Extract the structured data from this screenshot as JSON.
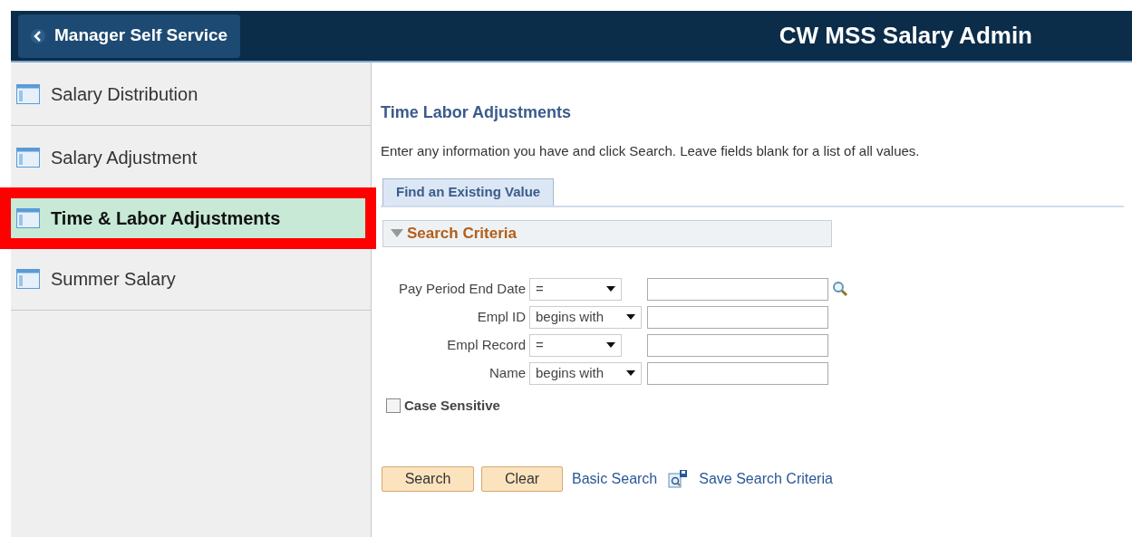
{
  "header": {
    "back_button": "Manager Self Service",
    "title": "CW MSS Salary Admin"
  },
  "sidebar": {
    "items": [
      {
        "label": "Salary Distribution",
        "selected": false,
        "highlighted": false
      },
      {
        "label": "Salary Adjustment",
        "selected": false,
        "highlighted": false
      },
      {
        "label": "Time & Labor Adjustments",
        "selected": true,
        "highlighted": true
      },
      {
        "label": "Summer Salary",
        "selected": false,
        "highlighted": false
      }
    ]
  },
  "page": {
    "title": "Time Labor Adjustments",
    "instructions": "Enter any information you have and click Search. Leave fields blank for a list of all values.",
    "tabs": [
      {
        "label": "Find an Existing Value",
        "selected": true
      }
    ],
    "section": {
      "title": "Search Criteria",
      "expanded": true
    },
    "fields": [
      {
        "label": "Pay Period End Date",
        "operator": "=",
        "lookup": true
      },
      {
        "label": "Empl ID",
        "operator": "begins with",
        "lookup": false
      },
      {
        "label": "Empl Record",
        "operator": "=",
        "lookup": false
      },
      {
        "label": "Name",
        "operator": "begins with",
        "lookup": false
      }
    ],
    "case_sensitive": {
      "label": "Case Sensitive",
      "checked": false
    },
    "buttons": [
      "Search",
      "Clear"
    ],
    "links": {
      "basic_search": "Basic Search",
      "save_criteria": "Save Search Criteria"
    }
  }
}
